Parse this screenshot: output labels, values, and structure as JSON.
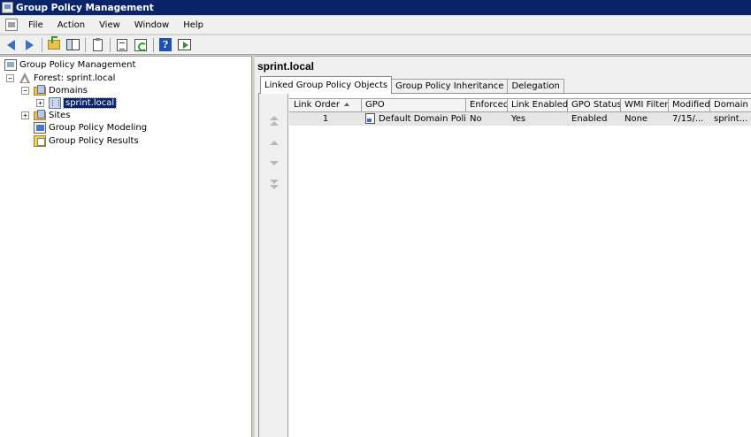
{
  "window": {
    "title": "Group Policy Management"
  },
  "menu": [
    "File",
    "Action",
    "View",
    "Window",
    "Help"
  ],
  "toolbar_icons": [
    "back-icon",
    "forward-icon",
    "up-folder-icon",
    "show-hide-tree-icon",
    "clipboard-icon",
    "properties-icon",
    "refresh-icon",
    "help-icon",
    "action-pane-icon"
  ],
  "tree": {
    "root": "Group Policy Management",
    "forest": "Forest: sprint.local",
    "domains": "Domains",
    "domain": "sprint.local",
    "sites": "Sites",
    "modeling": "Group Policy Modeling",
    "results": "Group Policy Results",
    "expand_minus": "−",
    "expand_plus": "+"
  },
  "right": {
    "title": "sprint.local",
    "tabs": [
      "Linked Group Policy Objects",
      "Group Policy Inheritance",
      "Delegation"
    ],
    "columns": [
      "Link Order",
      "GPO",
      "Enforced",
      "Link Enabled",
      "GPO Status",
      "WMI Filter",
      "Modified",
      "Domain"
    ],
    "rows": [
      {
        "link_order": "1",
        "gpo": "Default Domain Policy",
        "enforced": "No",
        "link_enabled": "Yes",
        "gpo_status": "Enabled",
        "wmi_filter": "None",
        "modified": "7/15/...",
        "domain": "sprint..."
      }
    ]
  },
  "colors": {
    "titlebar": "#0a246a",
    "selection": "#0a246a",
    "row_highlight": "#e6e6e6"
  }
}
